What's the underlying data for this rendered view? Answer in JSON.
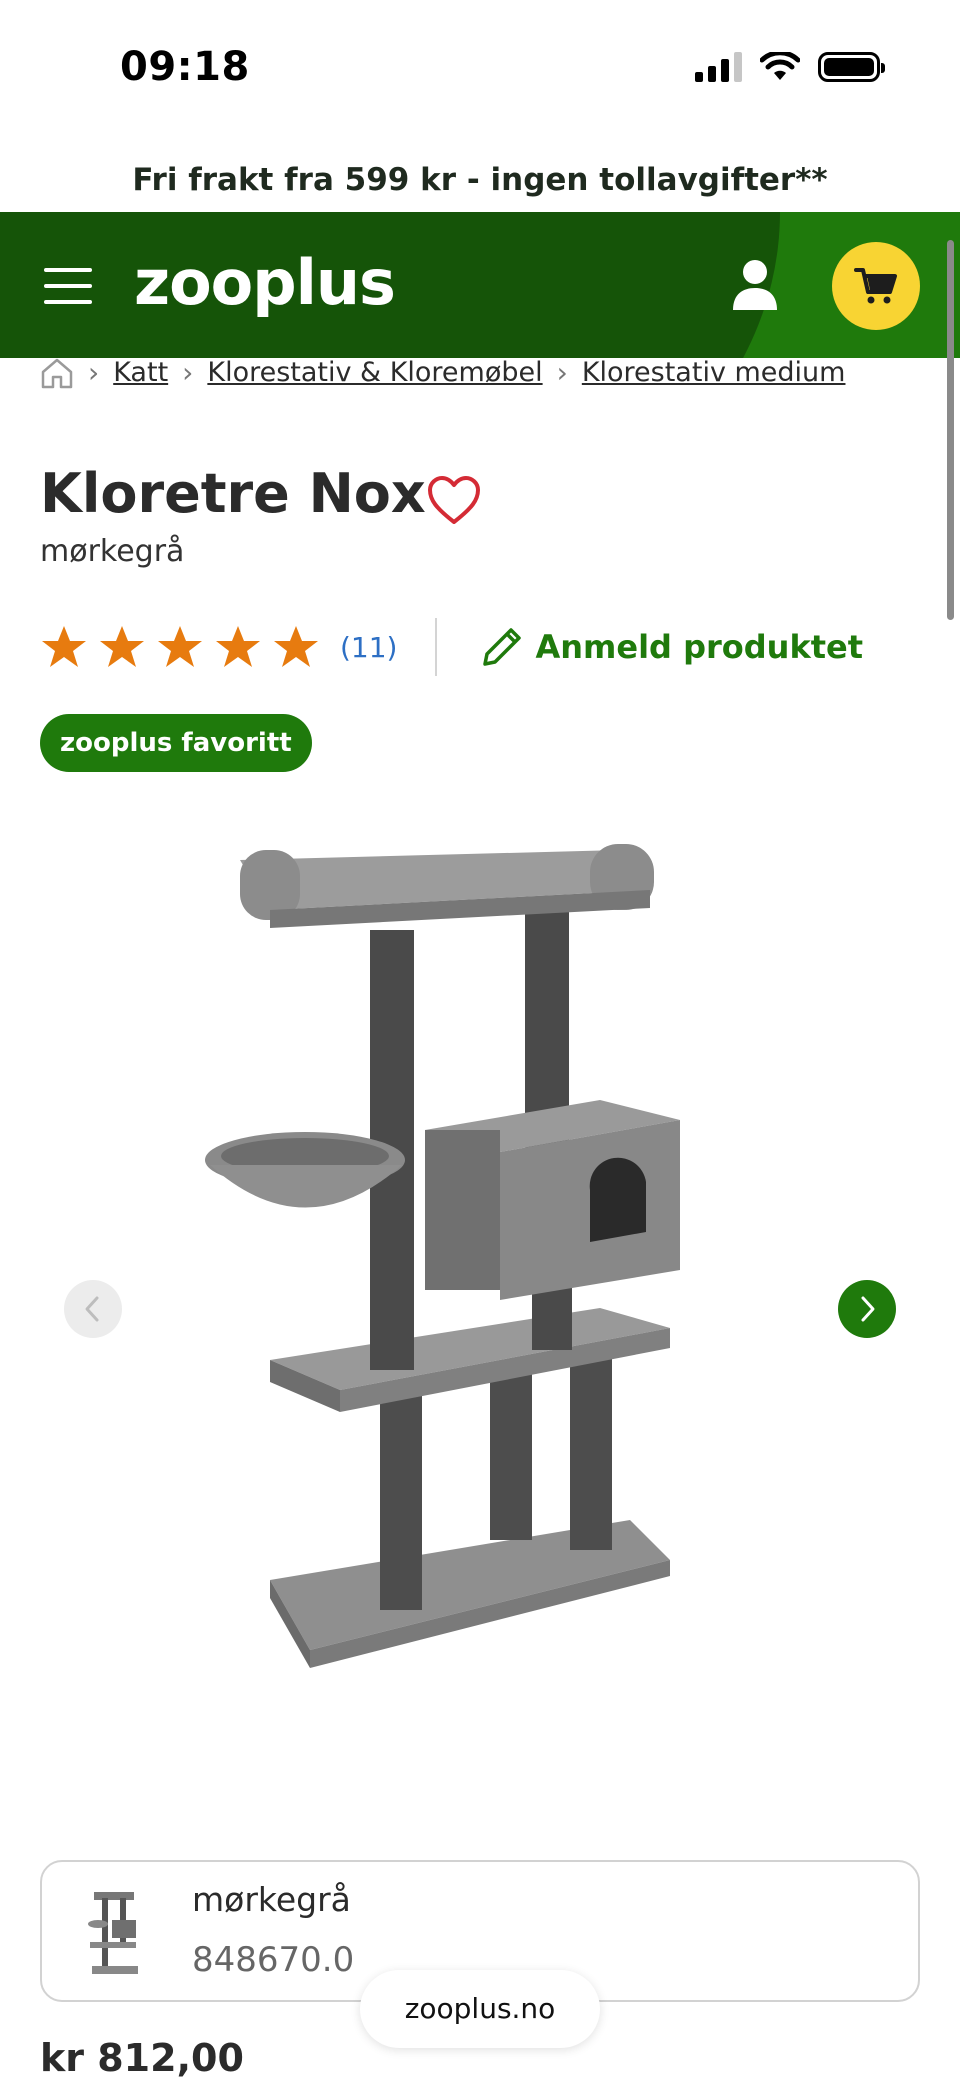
{
  "status_bar": {
    "time": "09:18"
  },
  "promo": {
    "text": "Fri frakt fra 599 kr - ingen tollavgifter**"
  },
  "header": {
    "logo": "zooplus",
    "colors": {
      "green": "#1f7a0c",
      "dark_green": "#155408",
      "cart_yellow": "#f8d433"
    }
  },
  "breadcrumb": {
    "items": [
      "Katt",
      "Klorestativ & Kloremøbel",
      "Klorestativ medium"
    ]
  },
  "product": {
    "title": "Kloretre Nox",
    "subtitle": "mørkegrå",
    "rating": 5,
    "review_count": "(11)",
    "review_link": "Anmeld produktet",
    "badge": "zooplus favoritt"
  },
  "gallery": {
    "image_icon": "cat-tree-image",
    "prev_icon": "chevron-left-icon",
    "next_icon": "chevron-right-icon"
  },
  "variant": {
    "name": "mørkegrå",
    "sku": "848670.0"
  },
  "browser": {
    "domain": "zooplus.no"
  },
  "price": {
    "text": "kr 812,00"
  }
}
